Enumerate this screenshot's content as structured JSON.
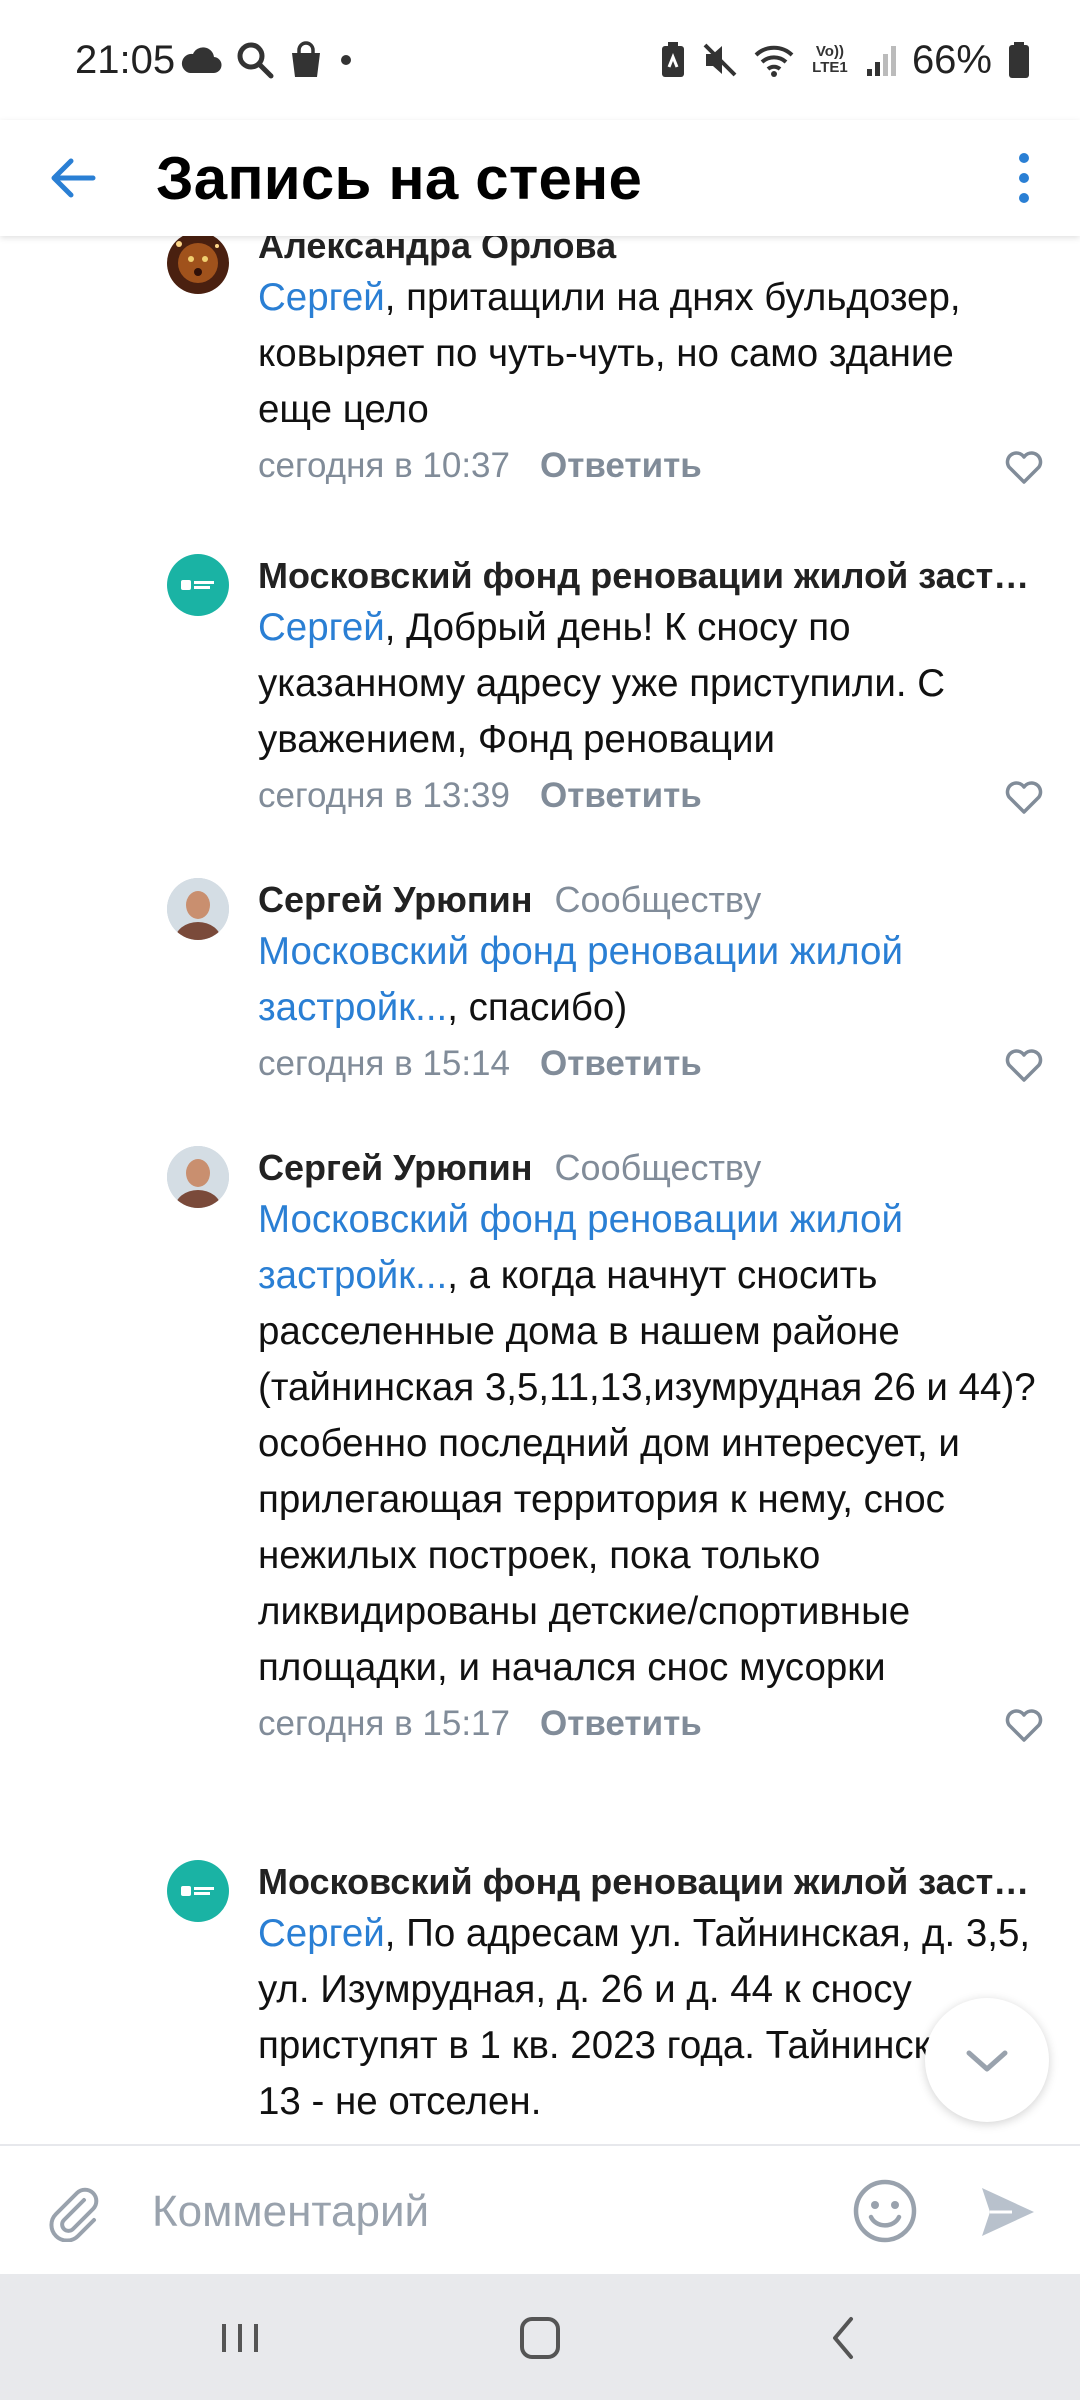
{
  "status_bar": {
    "time": "21:05",
    "battery_text": "66%",
    "left_icons": [
      "cloud-icon",
      "search-icon",
      "shopping-bag-icon",
      "dot-icon"
    ],
    "right_icons": [
      "battery-saver-icon",
      "mute-icon",
      "wifi-icon",
      "volte-icon",
      "signal-icon",
      "battery-icon"
    ],
    "volte_label": "Vo)) LTE1"
  },
  "app_bar": {
    "title": "Запись на стене",
    "back_icon": "arrow-left-icon",
    "more_icon": "more-vertical-icon"
  },
  "colors": {
    "link": "#2a7fd4",
    "meta": "#818c99",
    "accent": "#2a7fd4",
    "org_avatar": "#1ab3a4"
  },
  "comments": [
    {
      "author": "Александра Орлова",
      "tag": "",
      "mention": "Сергей",
      "text": ", притащили на днях бульдозер, ковыряет по чуть-чуть, но само здание еще цело",
      "time": "сегодня в 10:37",
      "reply": "Ответить"
    },
    {
      "author": "Московский фонд реновации жилой застройки",
      "tag": "",
      "mention": "Сергей",
      "text": ", Добрый день! К сносу по указанному адресу уже приступили. С уважением, Фонд реновации",
      "time": "сегодня в 13:39",
      "reply": "Ответить"
    },
    {
      "author": "Сергей Урюпин",
      "tag": "Сообществу",
      "mention": "Московский фонд реновации жилой застройк...",
      "text": ", спасибо)",
      "time": "сегодня в 15:14",
      "reply": "Ответить"
    },
    {
      "author": "Сергей Урюпин",
      "tag": "Сообществу",
      "mention": "Московский фонд реновации жилой застройк...",
      "text": ", а когда начнут сносить расселенные дома в нашем районе (тайнинская 3,5,11,13,изумрудная 26 и 44)? особенно последний дом интересует, и прилегающая территория к нему, снос нежилых построек, пока только ликвидированы детские/спортивные площадки, и начался снос мусорки",
      "time": "сегодня в 15:17",
      "reply": "Ответить"
    },
    {
      "author": "Московский фонд реновации жилой застройки",
      "tag": "",
      "mention": "Сергей",
      "text": ", По адресам ул. Тайнинская, д. 3,5, ул. Изумрудная, д. 26 и д. 44 к сносу приступят в 1 кв. 2023 года. Тайнинская, д. 13 - не отселен."
    }
  ],
  "composer": {
    "placeholder": "Комментарий",
    "attach_icon": "paperclip-icon",
    "emoji_icon": "smile-icon",
    "send_icon": "send-icon"
  },
  "fab": {
    "icon": "chevron-down-icon"
  },
  "nav_bar": {
    "icons": [
      "recents-icon",
      "home-icon",
      "back-icon"
    ]
  }
}
